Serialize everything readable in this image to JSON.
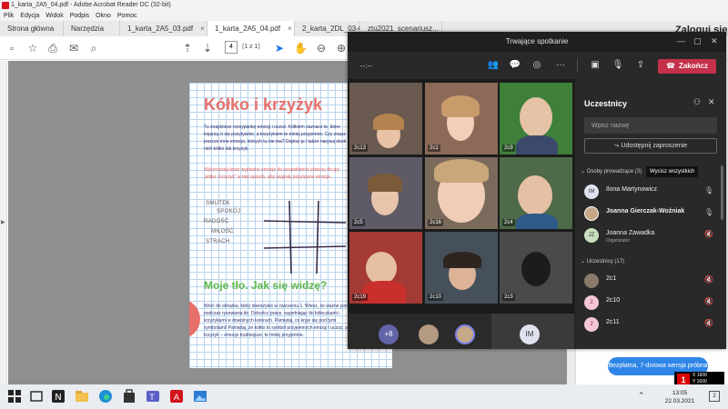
{
  "acrobat": {
    "window_title": "1_karta_2A5_04.pdf - Adobe Acrobat Reader DC (32-bit)",
    "menu": [
      "Plik",
      "Edycja",
      "Widok",
      "Podpis",
      "Okno",
      "Pomoc"
    ],
    "tabs": [
      "Strona główna",
      "Narzędzia",
      "1_karta_2A5_03.pdf",
      "1_karta_2A5_04.pdf",
      "2_karta_2DL_03-04....",
      "ztu2021_scenariusz..."
    ],
    "signin": "Zaloguj się",
    "page_number": "4",
    "page_count": "(1 z 1)"
  },
  "worksheet": {
    "title": "Kółko i krzyżyk",
    "para1": "Tu znajdziesz rozsypankę emocji i uczuć. Kółkiem zaznacz te, które kojarzą ci się pozytywnie, a krzyżykiem te mniej przyjemne. Czy znasz jeszcze inne emocje, których tu nie ma? Dopisz je i także narysuj obok nich kółko lub krzyżyk.",
    "para2": "Wykorzystaj teraz wypisane emocje do uzupełnienia planszy do gry „kółko i krzyżyk” w taki sposób, aby wygrały pozytywne emocje.",
    "emotions": [
      "SMUTEK",
      "SPOKÓJ",
      "RADOŚĆ",
      "MIŁOŚĆ",
      "STRACH"
    ],
    "heading2": "Moje tło. Jak się widzę?",
    "para3": "Wróć do obrazka, który stworzyłeś w ćwiczeniu 1. Wiesz, że ważne jest podczas rysowania tło. Dokończ pracę, wypełniając tło kółeczkami i krzyżykami w dowolnych kolorach. Pamiętaj, co kryje się pod tymi symbolami! Pamiętaj, że kółko to symbol przyjemnych emocji i uczuć, a krzyżyk – emocje trudniejsze, te mniej przyjemne."
  },
  "teams": {
    "title": "Trwające spotkanie",
    "timer": "--:--",
    "end_label": "Zakończ",
    "tiles": [
      "2c13",
      "2c1",
      "2c9",
      "2c5",
      "2c16",
      "2c4",
      "2c19",
      "2c10",
      "2c3"
    ],
    "more_count": "+8",
    "self_initials": "IM"
  },
  "participants": {
    "title": "Uczestnicy",
    "search_placeholder": "Wpisz nazwę",
    "share_label": "Udostępnij zaproszenie",
    "presenters_header": "Osoby prowadzące (3)",
    "mute_all": "Wycisz wszystkich",
    "presenters": [
      {
        "initials": "IM",
        "name": "Ilona Martynowicz",
        "role": ""
      },
      {
        "initials": "",
        "name": "Joanna Gierczak-Woźniak",
        "role": ""
      },
      {
        "initials": "JZ",
        "name": "Joanna Zawadka",
        "role": "Organizator"
      }
    ],
    "attendees_header": "Uczestnicy (17)",
    "attendees": [
      {
        "initials": "",
        "name": "2c1"
      },
      {
        "initials": "2",
        "name": "2c10"
      },
      {
        "initials": "2",
        "name": "2c11"
      }
    ]
  },
  "desktop": {
    "trial_label": "Bezpłatna, 7-dniowa wersja próbna",
    "res_num": "1",
    "res_x": "X 1600",
    "res_y": "Y 1600",
    "time": "13:05",
    "date": "22.03.2021",
    "notify_count": "2"
  }
}
